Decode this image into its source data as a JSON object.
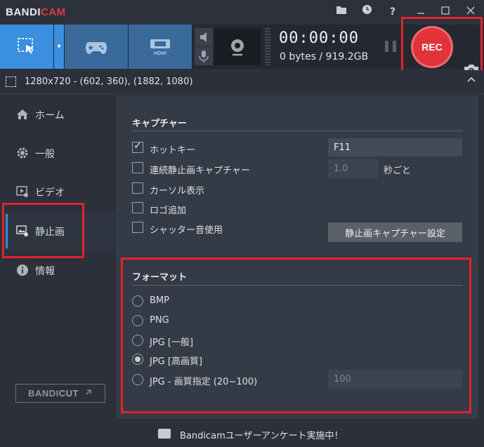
{
  "app": {
    "logo_prefix": "BANDI",
    "logo_suffix": "CAM"
  },
  "titlebar": {
    "icons": [
      "folder-icon",
      "clock-icon",
      "help-icon",
      "minimize-icon",
      "maximize-icon",
      "close-icon"
    ],
    "help_glyph": "?"
  },
  "toolbar": {
    "modes": [
      "rectangle-mode-icon",
      "game-mode-icon",
      "hdmi-mode-icon"
    ],
    "hdmi_label": "HDMI",
    "timer": "00:00:00",
    "size": "0 bytes / 919.2GB",
    "rec_label": "REC"
  },
  "region": {
    "text": "1280x720 - (602, 360), (1882, 1080)"
  },
  "sidebar": {
    "items": [
      {
        "label": "ホーム",
        "icon": "home-icon"
      },
      {
        "label": "一般",
        "icon": "gear-icon"
      },
      {
        "label": "ビデオ",
        "icon": "video-icon"
      },
      {
        "label": "静止画",
        "icon": "image-icon"
      },
      {
        "label": "情報",
        "icon": "info-icon"
      }
    ],
    "bandicut_prefix": "BANDI",
    "bandicut_suffix": "CUT"
  },
  "capture": {
    "title": "キャプチャー",
    "hotkey_label": "ホットキー",
    "hotkey_value": "F11",
    "continuous_label": "連続静止画キャプチャー",
    "interval_value": "1.0",
    "interval_unit": "秒ごと",
    "cursor_label": "カーソル表示",
    "logo_label": "ロゴ追加",
    "shutter_label": "シャッター音使用",
    "settings_button": "静止画キャプチャー設定"
  },
  "format": {
    "title": "フォーマット",
    "options": [
      "BMP",
      "PNG",
      "JPG [一般]",
      "JPG [高画質]",
      "JPG - 画質指定 (20~100)"
    ],
    "selected": "JPG [高画質]",
    "quality_value": "100"
  },
  "footer": {
    "text": "Bandicamユーザーアンケート実施中！"
  },
  "colors": {
    "accent": "#3a8fe0",
    "rec": "#e2333a",
    "highlight": "#e3232b"
  }
}
